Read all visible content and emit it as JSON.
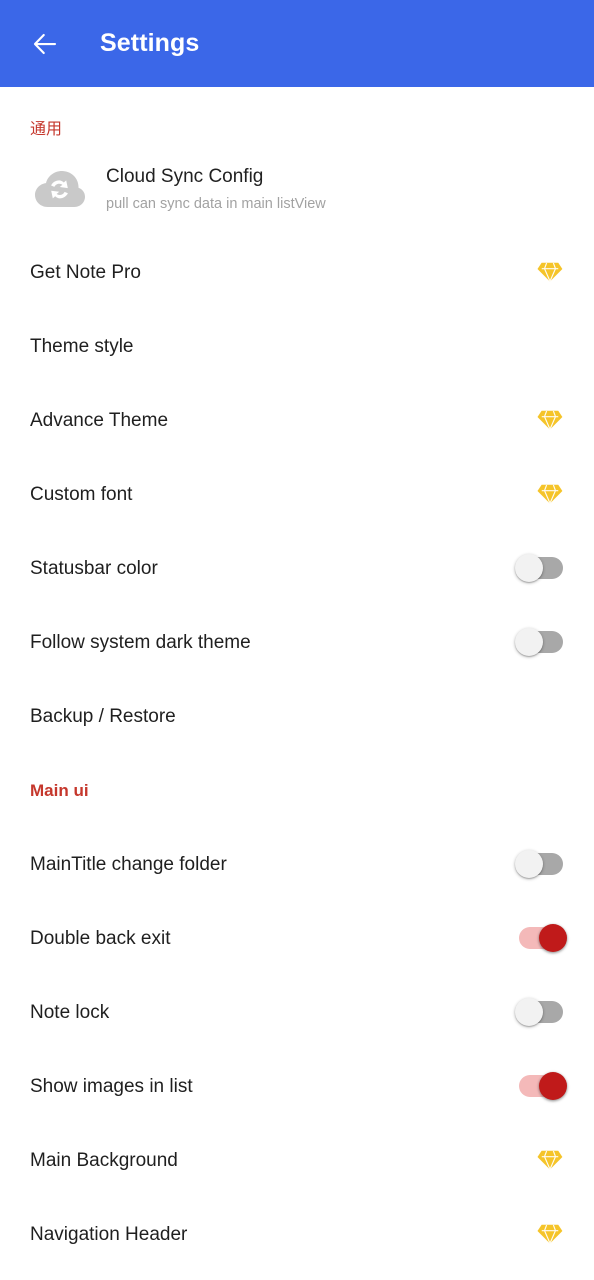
{
  "appbar": {
    "back_icon": "arrow-left-icon",
    "title": "Settings",
    "background_color": "#3b67e8",
    "title_color": "#ffffff"
  },
  "colors": {
    "section_header": "#c5372c",
    "gem": "#f5c429",
    "toggle_on_track": "#f4b9b9",
    "toggle_on_thumb": "#c01a1a",
    "toggle_off_track": "#a8a8a8",
    "toggle_off_thumb": "#f2f2f2",
    "primary_text": "#1f1f1f",
    "secondary_text": "#a2a2a2"
  },
  "sections": [
    {
      "header": "通用",
      "header_style": "normal"
    },
    {
      "header": "Main ui",
      "header_style": "bold"
    }
  ],
  "general": {
    "header": "通用",
    "cloud_sync": {
      "icon": "cloud-sync-icon",
      "title": "Cloud Sync Config",
      "subtitle": "pull can sync data in main listView"
    },
    "items": [
      {
        "label": "Get Note Pro",
        "accessory": "gem",
        "icon": "gem-icon"
      },
      {
        "label": "Theme style",
        "accessory": "none",
        "icon": ""
      },
      {
        "label": "Advance Theme",
        "accessory": "gem",
        "icon": "gem-icon"
      },
      {
        "label": "Custom font",
        "accessory": "gem",
        "icon": "gem-icon"
      },
      {
        "label": "Statusbar color",
        "accessory": "switch",
        "icon": "toggle-switch",
        "value": "off"
      },
      {
        "label": "Follow system dark theme",
        "accessory": "switch",
        "icon": "toggle-switch",
        "value": "off"
      },
      {
        "label": "Backup / Restore",
        "accessory": "none",
        "icon": ""
      }
    ]
  },
  "main_ui": {
    "header": "Main ui",
    "items": [
      {
        "label": "MainTitle change folder",
        "accessory": "switch",
        "icon": "toggle-switch",
        "value": "off"
      },
      {
        "label": "Double back exit",
        "accessory": "switch",
        "icon": "toggle-switch",
        "value": "on"
      },
      {
        "label": "Note lock",
        "accessory": "switch",
        "icon": "toggle-switch",
        "value": "off"
      },
      {
        "label": "Show images in list",
        "accessory": "switch",
        "icon": "toggle-switch",
        "value": "on"
      },
      {
        "label": "Main Background",
        "accessory": "gem",
        "icon": "gem-icon"
      },
      {
        "label": "Navigation Header",
        "accessory": "gem",
        "icon": "gem-icon"
      }
    ]
  }
}
